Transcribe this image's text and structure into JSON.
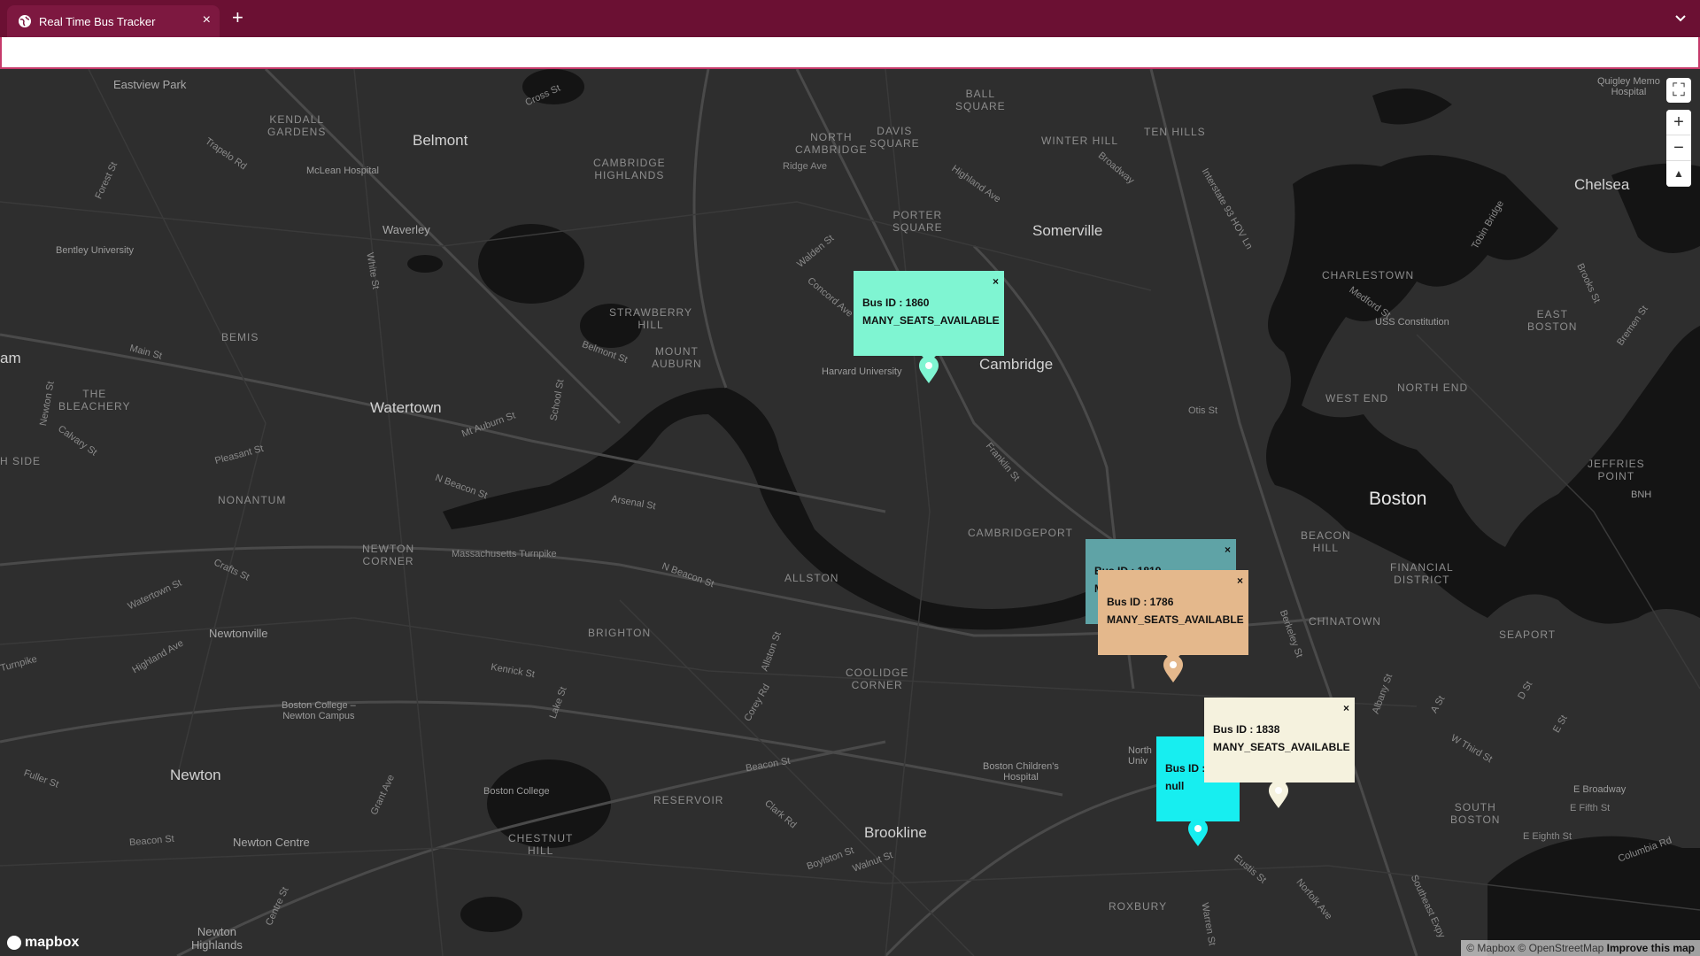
{
  "browser": {
    "tab_title": "Real Time Bus Tracker",
    "tab_close": "×",
    "new_tab": "+",
    "url": ""
  },
  "map": {
    "labels": {
      "eastview_park": "Eastview Park",
      "kendall_gardens": "KENDALL\nGARDENS",
      "belmont": "Belmont",
      "mclean": "McLean Hospital",
      "waverley": "Waverley",
      "bentley": "Bentley University",
      "cambridge_highlands": "CAMBRIDGE\nHIGHLANDS",
      "north_cambridge": "NORTH\nCAMBRIDGE",
      "davis_square": "DAVIS\nSQUARE",
      "ball_square": "BALL\nSQUARE",
      "winter_hill": "WINTER HILL",
      "ten_hills": "TEN HILLS",
      "quigley": "Quigley Memo\nHospital",
      "chelsea": "Chelsea",
      "porter_square": "PORTER\nSQUARE",
      "somerville": "Somerville",
      "strawberry_hill": "STRAWBERRY\nHILL",
      "mount_auburn": "MOUNT\nAUBURN",
      "cambridge": "Cambridge",
      "charlestown": "CHARLESTOWN",
      "east_boston": "EAST\nBOSTON",
      "uss_constitution": "USS Constitution",
      "the_bleachery": "THE\nBLEACHERY",
      "bemis": "BEMIS",
      "watertown": "Watertown",
      "harvard": "Harvard University",
      "north_end": "NORTH END",
      "west_end": "WEST END",
      "jeffries_point": "JEFFRIES\nPOINT",
      "nonantum": "NONANTUM",
      "boston": "Boston",
      "bnh": "BNH",
      "beacon_hill": "BEACON\nHILL",
      "financial_district": "FINANCIAL\nDISTRICT",
      "cambridgeport": "CAMBRIDGEPORT",
      "newton_corner": "NEWTON\nCORNER",
      "allston": "ALLSTON",
      "chinatown": "CHINATOWN",
      "seaport": "SEAPORT",
      "newtonville": "Newtonville",
      "brighton": "BRIGHTON",
      "coolidge_corner": "COOLIDGE\nCORNER",
      "bc_newton": "Boston College –\nNewton Campus",
      "newton": "Newton",
      "boston_college": "Boston College",
      "reservoir": "RESERVOIR",
      "bch": "Boston Children's\nHospital",
      "north_univ": "North\nUniv",
      "south_boston": "SOUTH\nBOSTON",
      "newton_centre": "Newton Centre",
      "chestnut_hill": "CHESTNUT\nHILL",
      "brookline": "Brookline",
      "roxbury": "ROXBURY",
      "newton_highlands": "Newton\nHighlands",
      "e_broadway": "E Broadway",
      "e_fifth": "E Fifth St",
      "e_eighth": "E Eighth St",
      "ham": "am",
      "h_side": "H SIDE"
    },
    "streets": {
      "cross_st": "Cross St",
      "trapelo": "Trapelo Rd",
      "forest": "Forest St",
      "ridge": "Ridge Ave",
      "walden": "Walden St",
      "concord": "Concord Ave",
      "highland": "Highland Ave",
      "broadway": "Broadway",
      "i93": "Interstate 93 HOV Ln",
      "medford": "Medford St",
      "main": "Main St",
      "belmont_st": "Belmont St",
      "school": "School St",
      "mt_auburn": "Mt Auburn St",
      "pleasant": "Pleasant St",
      "calvary": "Calvary St",
      "n_beacon": "N Beacon St",
      "arsenal": "Arsenal St",
      "franklin": "Franklin St",
      "otis": "Otis St",
      "mass_tpk": "Massachusetts Turnpike",
      "n_beacon2": "N Beacon St",
      "crafts": "Crafts St",
      "watertown_st": "Watertown St",
      "highland_ave2": "Highland Ave",
      "turnpike": "Turnpike",
      "kenrick": "Kenrick St",
      "lake": "Lake St",
      "allston_st": "Allston St",
      "corey": "Corey Rd",
      "beacon": "Beacon St",
      "clark": "Clark Rd",
      "boylston": "Boylston St",
      "walnut": "Walnut St",
      "fuller": "Fuller St",
      "grant": "Grant Ave",
      "beacon2": "Beacon St",
      "centre": "Centre St",
      "berkeley": "Berkeley St",
      "albany": "Albany St",
      "a_st": "A St",
      "w_third": "W Third St",
      "d_st": "D St",
      "e_st": "E St",
      "columbia": "Columbia Rd",
      "eustis": "Eustis St",
      "norfolk": "Norfolk Ave",
      "warren": "Warren St",
      "southeast_exp": "Southeast Expy",
      "tobin": "Tobin Bridge",
      "bremen": "Bremen St",
      "brooks": "Brooks St",
      "newton_st": "Newton St",
      "white_st": "White St"
    },
    "popups": [
      {
        "line1": "Bus ID : 1860",
        "line2": "MANY_SEATS_AVAILABLE",
        "color": "#7ff5d2",
        "close": "×"
      },
      {
        "line1": "Bus ID : 1819",
        "line2": "M",
        "color": "#5fa3a6",
        "close": "×"
      },
      {
        "line1": "Bus ID : 1786",
        "line2": "MANY_SEATS_AVAILABLE",
        "color": "#e4b88c",
        "close": "×"
      },
      {
        "line1": "Bus ID :",
        "line2": "null",
        "color": "#17eef0",
        "close": "×"
      },
      {
        "line1": "Bus ID : 1838",
        "line2": "MANY_SEATS_AVAILABLE",
        "color": "#f5f2de",
        "close": "×"
      }
    ],
    "controls": {
      "fullscreen": "⛶",
      "zoom_in": "+",
      "zoom_out": "−",
      "compass": "▲"
    },
    "logo": "mapbox",
    "attribution": "© Mapbox © OpenStreetMap",
    "improve": "Improve this map"
  }
}
